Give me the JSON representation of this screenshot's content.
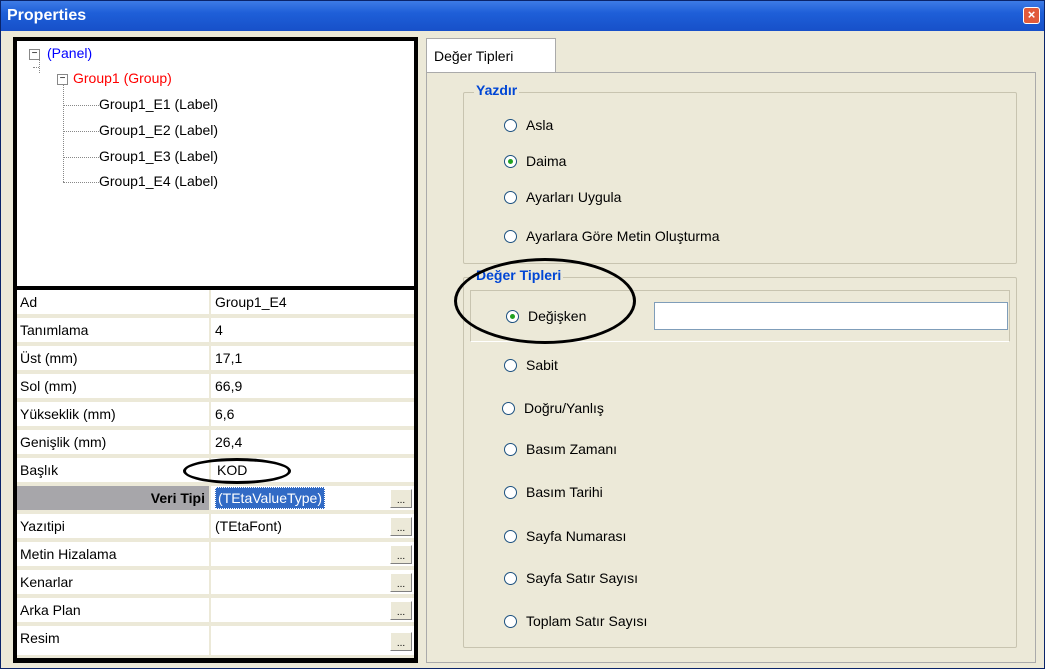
{
  "window": {
    "title": "Properties",
    "close_icon": "×"
  },
  "tree": {
    "collapse_glyph": "−",
    "items": [
      {
        "label": "(Panel)"
      },
      {
        "label": "Group1 (Group)"
      },
      {
        "label": "Group1_E1 (Label)"
      },
      {
        "label": "Group1_E2 (Label)"
      },
      {
        "label": "Group1_E3 (Label)"
      },
      {
        "label": "Group1_E4 (Label)"
      }
    ]
  },
  "properties": {
    "ellipsis": "...",
    "rows": [
      {
        "name": "Ad",
        "value": "Group1_E4"
      },
      {
        "name": "Tanımlama",
        "value": "4"
      },
      {
        "name": "Üst  (mm)",
        "value": "17,1"
      },
      {
        "name": "Sol (mm)",
        "value": "66,9"
      },
      {
        "name": "Yükseklik  (mm)",
        "value": "6,6"
      },
      {
        "name": "Genişlik  (mm)",
        "value": "26,4"
      },
      {
        "name": "Başlık",
        "value": "KOD"
      },
      {
        "name": "Veri Tipi",
        "value": "(TEtaValueType)"
      },
      {
        "name": "Yazıtipi",
        "value": "(TEtaFont)"
      },
      {
        "name": "Metin Hizalama",
        "value": ""
      },
      {
        "name": "Kenarlar",
        "value": ""
      },
      {
        "name": "Arka Plan",
        "value": ""
      },
      {
        "name": "Resim",
        "value": ""
      }
    ]
  },
  "tab": {
    "label": "Değer Tipleri"
  },
  "yazdir": {
    "title": "Yazdır",
    "options": [
      "Asla",
      "Daima",
      "Ayarları Uygula",
      "Ayarlara Göre Metin Oluşturma"
    ],
    "selected": "Daima"
  },
  "deger_tipleri": {
    "title": "Değer Tipleri",
    "options": [
      "Değişken",
      "Sabit",
      "Doğru/Yanlış",
      "Basım Zamanı",
      "Basım Tarihi",
      "Sayfa Numarası",
      "Sayfa Satır Sayısı",
      "Toplam Satır Sayısı"
    ],
    "selected": "Değişken",
    "input_value": ""
  }
}
